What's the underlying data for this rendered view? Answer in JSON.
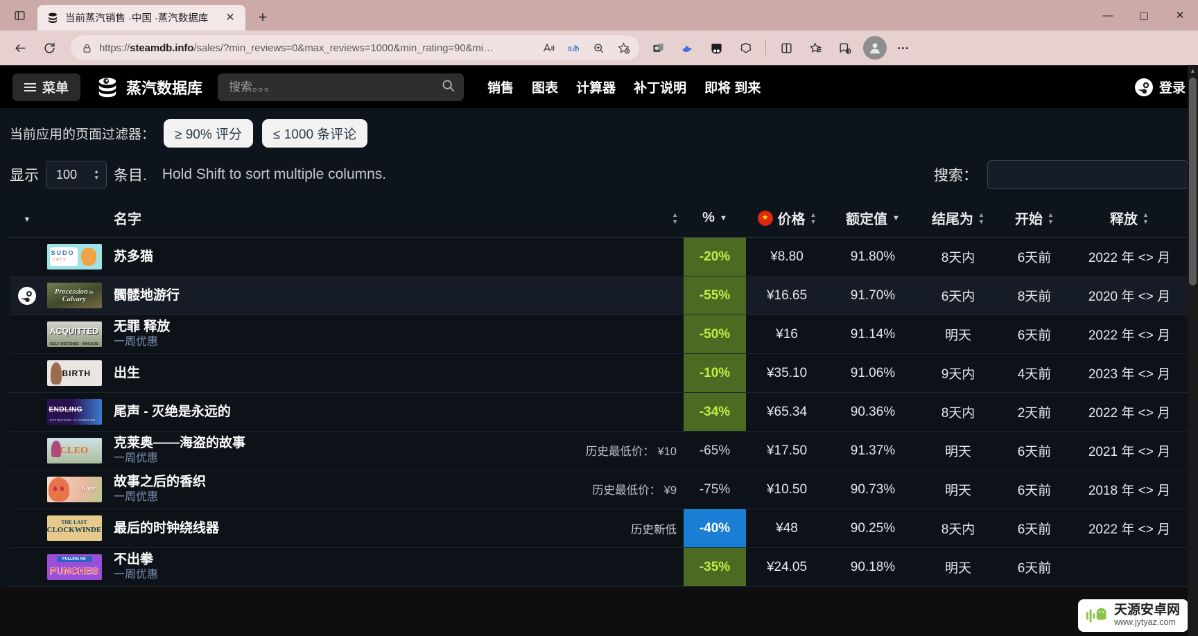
{
  "browser": {
    "tab": {
      "title": "当前蒸汽销售 ·中国 ·蒸汽数据库",
      "favicon_icon": "steamdb-icon",
      "close_icon": "close-icon"
    },
    "newtab_label": "+",
    "window_controls": {
      "minimize": "—",
      "maximize": "▢",
      "close": "✕"
    },
    "toolbar": {
      "back_icon": "back-arrow-icon",
      "reload_icon": "reload-icon",
      "lock_icon": "lock-icon",
      "url_prefix": "https://",
      "url_domain": "steamdb.info",
      "url_path": "/sales/?min_reviews=0&max_reviews=1000&min_rating=90&mi…",
      "read_aloud_icon": "read-aloud-icon",
      "translate_icon": "translate-icon",
      "zoom_icon": "zoom-icon",
      "favorite_icon": "add-favorite-icon",
      "outlook_icon": "outlook-icon",
      "bird_icon": "bird-app-icon",
      "split_icon": "split-screen-icon",
      "copilot_icon": "copilot-icon",
      "browser_essentials_icon": "browser-essentials-icon",
      "collections_icon": "collections-icon",
      "favorites_icon": "favorites-bar-icon",
      "settings_icon": "more-settings-icon",
      "profile_icon": "profile-avatar-icon"
    }
  },
  "site": {
    "menu_label": "菜单",
    "brand": "蒸汽数据库",
    "search_placeholder": "搜索。。。",
    "search_value": "",
    "search_icon": "search-icon",
    "nav": [
      {
        "label": "销售"
      },
      {
        "label": "图表"
      },
      {
        "label": "计算器"
      },
      {
        "label": "补丁说明"
      },
      {
        "label": "即将 到来"
      }
    ],
    "login_label": "登录",
    "login_icon": "steam-logo-icon"
  },
  "filters": {
    "label": "当前应用的页面过滤器：",
    "chips": [
      "≥ 90% 评分",
      "≤ 1000 条评论"
    ]
  },
  "controls": {
    "show_label": "显示",
    "length_value": "100",
    "entries_label": "条目.",
    "hint": "Hold Shift to sort multiple columns.",
    "search_label": "搜索：",
    "search_value": "",
    "search_placeholder": ""
  },
  "table": {
    "columns": [
      {
        "key": "expand",
        "label": "",
        "sort": "desc"
      },
      {
        "key": "img",
        "label": "",
        "sort": "none"
      },
      {
        "key": "name",
        "label": "名字",
        "sort": "both"
      },
      {
        "key": "pct",
        "label": "%",
        "sort": "desc"
      },
      {
        "key": "price",
        "label": "价格",
        "sort": "both",
        "icon": "china-flag-icon"
      },
      {
        "key": "rating",
        "label": "额定值",
        "sort": "desc"
      },
      {
        "key": "ends",
        "label": "结尾为",
        "sort": "both"
      },
      {
        "key": "starts",
        "label": "开始",
        "sort": "both"
      },
      {
        "key": "release",
        "label": "释放",
        "sort": "both"
      }
    ],
    "rows": [
      {
        "thumb": "sudo-cats-capsule",
        "thumb_text": "SUDO cats",
        "title": "苏多猫",
        "sub": "",
        "lowest": "",
        "pct": "-20%",
        "pct_style": "green",
        "price": "¥8.80",
        "rating": "91.80%",
        "ends": "8天内",
        "starts": "6天前",
        "release": "2022 年 <> 月",
        "steam_icon": false,
        "row_style": "normal"
      },
      {
        "thumb": "procession-calvary-capsule",
        "thumb_text": "The Procession to Calvary",
        "title": "髑髅地游行",
        "sub": "",
        "lowest": "",
        "pct": "-55%",
        "pct_style": "green",
        "price": "¥16.65",
        "rating": "91.70%",
        "ends": "6天内",
        "starts": "8天前",
        "release": "2020 年 <> 月",
        "steam_icon": true,
        "row_style": "alt"
      },
      {
        "thumb": "acquitted-capsule",
        "thumb_text": "ACQUITTED",
        "title": "无罪 释放",
        "sub": "一周优惠",
        "lowest": "",
        "pct": "-50%",
        "pct_style": "green",
        "price": "¥16",
        "rating": "91.14%",
        "ends": "明天",
        "starts": "6天前",
        "release": "2022 年 <> 月",
        "steam_icon": false,
        "row_style": "normal"
      },
      {
        "thumb": "birth-capsule",
        "thumb_text": "BIRTH",
        "title": "出生",
        "sub": "",
        "lowest": "",
        "pct": "-10%",
        "pct_style": "green",
        "price": "¥35.10",
        "rating": "91.06%",
        "ends": "9天内",
        "starts": "4天前",
        "release": "2023 年 <> 月",
        "steam_icon": false,
        "row_style": "normal"
      },
      {
        "thumb": "endling-capsule",
        "thumb_text": "ENDLING",
        "title": "尾声 - 灭绝是永远的",
        "sub": "",
        "lowest": "",
        "pct": "-34%",
        "pct_style": "green",
        "price": "¥65.34",
        "rating": "90.36%",
        "ends": "8天内",
        "starts": "2天前",
        "release": "2022 年 <> 月",
        "steam_icon": false,
        "row_style": "normal"
      },
      {
        "thumb": "cleo-capsule",
        "thumb_text": "CLEO",
        "title": "克莱奥——海盗的故事",
        "sub": "一周优惠",
        "lowest": "历史最低价： ¥10",
        "pct": "-65%",
        "pct_style": "plain",
        "price": "¥17.50",
        "rating": "91.37%",
        "ends": "明天",
        "starts": "6天前",
        "release": "2021 年 <> 月",
        "steam_icon": false,
        "row_style": "normal"
      },
      {
        "thumb": "kaori-capsule",
        "thumb_text": "Kaori",
        "title": "故事之后的香织",
        "sub": "一周优惠",
        "lowest": "历史最低价： ¥9",
        "pct": "-75%",
        "pct_style": "plain",
        "price": "¥10.50",
        "rating": "90.73%",
        "ends": "明天",
        "starts": "6天前",
        "release": "2018 年 <> 月",
        "steam_icon": false,
        "row_style": "normal"
      },
      {
        "thumb": "clockwinder-capsule",
        "thumb_text": "THE LAST CLOCKWINDER",
        "title": "最后的时钟绕线器",
        "sub": "",
        "lowest": "历史新低",
        "pct": "-40%",
        "pct_style": "blue",
        "price": "¥48",
        "rating": "90.25%",
        "ends": "8天内",
        "starts": "6天前",
        "release": "2022 年 <> 月",
        "steam_icon": false,
        "row_style": "normal"
      },
      {
        "thumb": "punches-capsule",
        "thumb_text": "PULLING NO PUNCHES",
        "title": "不出拳",
        "sub": "一周优惠",
        "lowest": "",
        "pct": "-35%",
        "pct_style": "green",
        "price": "¥24.05",
        "rating": "90.18%",
        "ends": "明天",
        "starts": "6天前",
        "release": "",
        "steam_icon": false,
        "row_style": "normal"
      }
    ]
  },
  "watermark": {
    "title": "天源安卓网",
    "url": "www.jytyaz.com",
    "logo_icon": "android-robot-icon"
  },
  "colors": {
    "page_bg": "#0e141b",
    "header_bg": "#000000",
    "discount_green": "#4c6b22",
    "discount_green_text": "#beee4a",
    "discount_blue": "#1a7fd4",
    "chip_bg": "#f2f2f2",
    "browser_chrome": "#e6d0d0"
  }
}
